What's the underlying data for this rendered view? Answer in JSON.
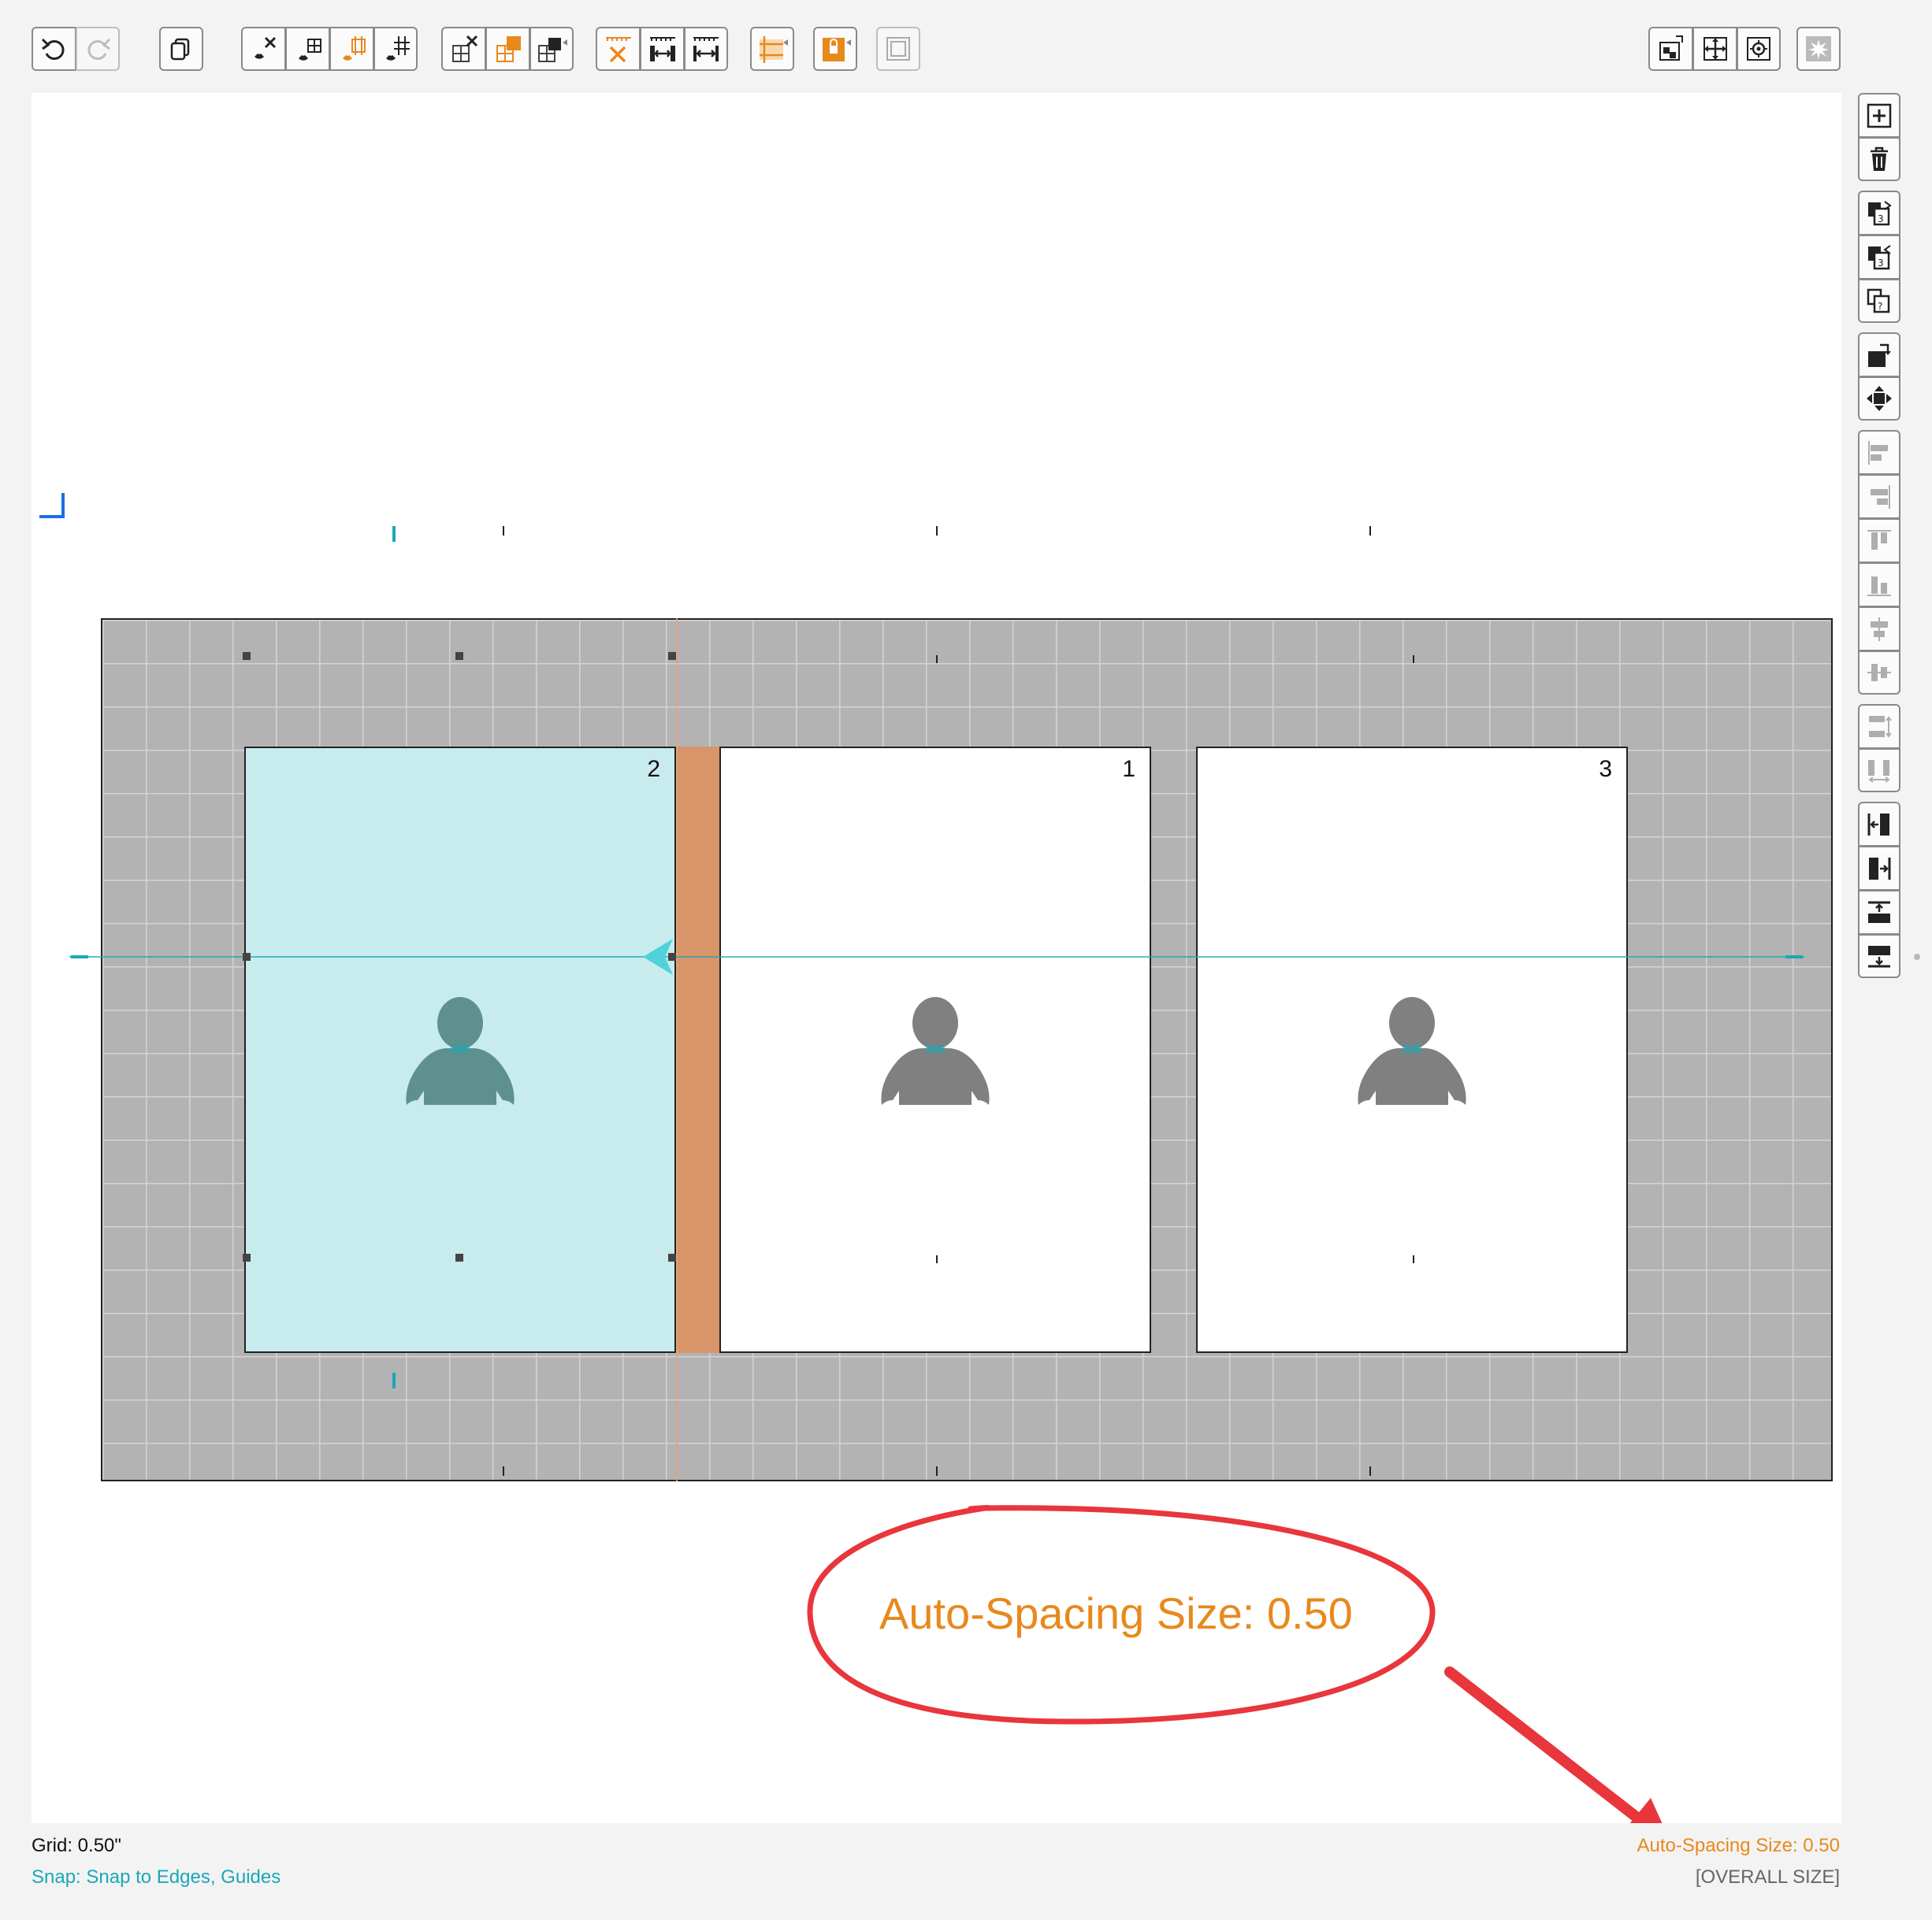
{
  "toolbar": {
    "undo": "undo-icon",
    "redo": "redo-icon",
    "duplicate": "duplicate-icon"
  },
  "panels": [
    {
      "number": "2",
      "selected": true
    },
    {
      "number": "1",
      "selected": false
    },
    {
      "number": "3",
      "selected": false
    }
  ],
  "annotation": {
    "callout_text": "Auto-Spacing Size: 0.50"
  },
  "status": {
    "grid": "Grid: 0.50\"",
    "snap": "Snap: Snap to Edges, Guides",
    "auto_spacing": "Auto-Spacing Size: 0.50",
    "overall_size": "[OVERALL SIZE]"
  },
  "colors": {
    "accent_orange": "#e8891c",
    "accent_teal": "#1aa8b8",
    "annotation_red": "#e8363c",
    "spacing_fill": "#d9956a",
    "selection_fill": "#c8ebee"
  }
}
